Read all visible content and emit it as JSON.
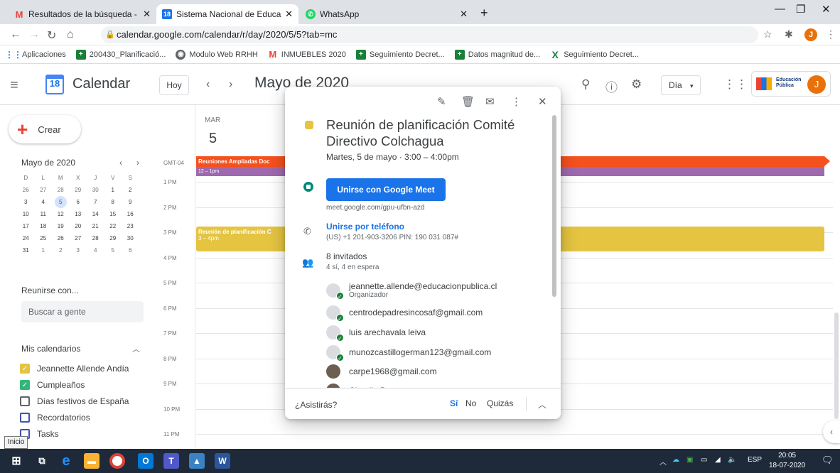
{
  "browser": {
    "tabs": [
      {
        "label": "Resultados de la búsqueda - jean",
        "icon": "gmail-icon"
      },
      {
        "label": "Sistema Nacional de Educación P",
        "icon": "calendar-icon"
      },
      {
        "label": "WhatsApp",
        "icon": "whatsapp-icon"
      }
    ],
    "url": "calendar.google.com/calendar/r/day/2020/5/5?tab=mc",
    "profile_initial": "J",
    "bookmarks": [
      {
        "label": "Aplicaciones",
        "icon": "apps-grid-icon",
        "color": "#1a73e8"
      },
      {
        "label": "200430_Planificació...",
        "icon": "sheets-icon",
        "color": "#188038"
      },
      {
        "label": "Modulo Web RRHH",
        "icon": "globe-icon",
        "color": "#5f6368"
      },
      {
        "label": "INMUEBLES 2020",
        "icon": "gmail-icon",
        "color": "#ea4335"
      },
      {
        "label": "Seguimiento Decret...",
        "icon": "sheets-icon",
        "color": "#188038"
      },
      {
        "label": "Datos magnitud de...",
        "icon": "sheets-icon",
        "color": "#188038"
      },
      {
        "label": "Seguimiento Decret...",
        "icon": "excel-icon",
        "color": "#188038"
      }
    ]
  },
  "header": {
    "logo_day": "18",
    "app_name": "Calendar",
    "today_label": "Hoy",
    "month_title": "Mayo de 2020",
    "view_label": "Día",
    "avatar_initial": "J",
    "brand_text": "Educación Pública"
  },
  "sidebar": {
    "create_label": "Crear",
    "mini_title": "Mayo de 2020",
    "weekdays": [
      "D",
      "L",
      "M",
      "X",
      "J",
      "V",
      "S"
    ],
    "weeks": [
      [
        "26",
        "27",
        "28",
        "29",
        "30",
        "1",
        "2"
      ],
      [
        "3",
        "4",
        "5",
        "6",
        "7",
        "8",
        "9"
      ],
      [
        "10",
        "11",
        "12",
        "13",
        "14",
        "15",
        "16"
      ],
      [
        "17",
        "18",
        "19",
        "20",
        "21",
        "22",
        "23"
      ],
      [
        "24",
        "25",
        "26",
        "27",
        "28",
        "29",
        "30"
      ],
      [
        "31",
        "1",
        "2",
        "3",
        "4",
        "5",
        "6"
      ]
    ],
    "meet_title": "Reunirse con...",
    "search_people": "Buscar a gente",
    "my_calendars_title": "Mis calendarios",
    "calendars": [
      {
        "label": "Jeannette Allende Andía",
        "checked": true,
        "color": "#e4c441"
      },
      {
        "label": "Cumpleaños",
        "checked": true,
        "color": "#33b679"
      },
      {
        "label": "Días festivos de España",
        "checked": false,
        "color": "#5f6368"
      },
      {
        "label": "Recordatorios",
        "checked": false,
        "color": "#3f51b5"
      },
      {
        "label": "Tasks",
        "checked": false,
        "color": "#3f51b5"
      }
    ]
  },
  "day_view": {
    "weekday": "MAR",
    "day_number": "5",
    "timezone": "GMT-04",
    "hours": [
      "1 PM",
      "2 PM",
      "3 PM",
      "4 PM",
      "5 PM",
      "6 PM",
      "7 PM",
      "8 PM",
      "9 PM",
      "10 PM",
      "11 PM"
    ],
    "events": {
      "red": "Reuniones Ampliadas Doc",
      "purple": "12 – 1pm",
      "yellow_title": "Reunión de planificación C",
      "yellow_time": "3 – 4pm"
    }
  },
  "popup": {
    "title": "Reunión de planificación Comité Directivo Colchagua",
    "date": "Martes, 5 de mayo  ·  3:00 – 4:00pm",
    "meet_button": "Unirse con Google Meet",
    "meet_url": "meet.google.com/gpu-ufbn-azd",
    "phone_link": "Unirse por teléfono",
    "phone_number": "(US) +1 201-903-3206 PIN: 190 031 087#",
    "guest_count": "8 invitados",
    "guest_status": "4 sí, 4 en espera",
    "guests": [
      {
        "name": "jeannette.allende@educacionpublica.cl",
        "sub": "Organizador"
      },
      {
        "name": "centrodepadresincosaf@gmail.com",
        "sub": ""
      },
      {
        "name": "luis arechavala leiva",
        "sub": ""
      },
      {
        "name": "munozcastillogerman123@gmail.com",
        "sub": ""
      },
      {
        "name": "carpe1968@gmail.com",
        "sub": ""
      },
      {
        "name": "Claudia Becerra",
        "sub": ""
      }
    ],
    "rsvp_question": "¿Asistirás?",
    "rsvp_yes": "Sí",
    "rsvp_no": "No",
    "rsvp_maybe": "Quizás"
  },
  "taskbar": {
    "lang": "ESP",
    "time": "20:05",
    "date": "18-07-2020",
    "tooltip": "Inicio"
  }
}
